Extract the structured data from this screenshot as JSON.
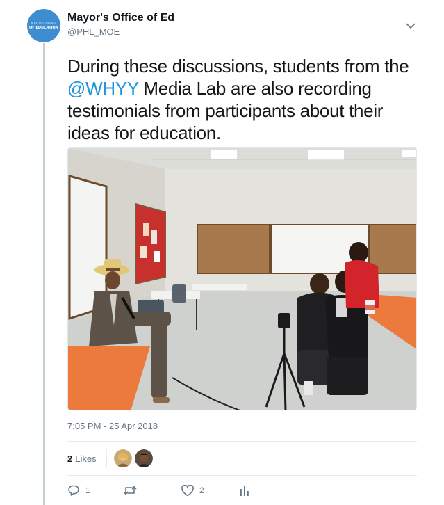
{
  "tweet": {
    "avatar_text_top": "MAYOR'S OFFICE",
    "avatar_text_bottom": "OF EDUCATION",
    "display_name": "Mayor's Office of Ed",
    "handle": "@PHL_MOE",
    "text_before": "During these discussions, students from the ",
    "mention": "@WHYY",
    "text_after": " Media Lab are also recording testimonials from participants about their ideas for education.",
    "timestamp": "7:05 PM - 25 Apr 2018",
    "likes_count": "2",
    "likes_label": "Likes",
    "actions": {
      "reply_count": "1",
      "retweet_count": "",
      "like_count": "2"
    }
  },
  "icons": [
    "chevron-down-icon",
    "reply-icon",
    "retweet-icon",
    "heart-icon",
    "analytics-icon"
  ],
  "colors": {
    "accent": "#1b95e0",
    "thread_line": "#c4cfd6",
    "secondary_text": "#657786"
  }
}
